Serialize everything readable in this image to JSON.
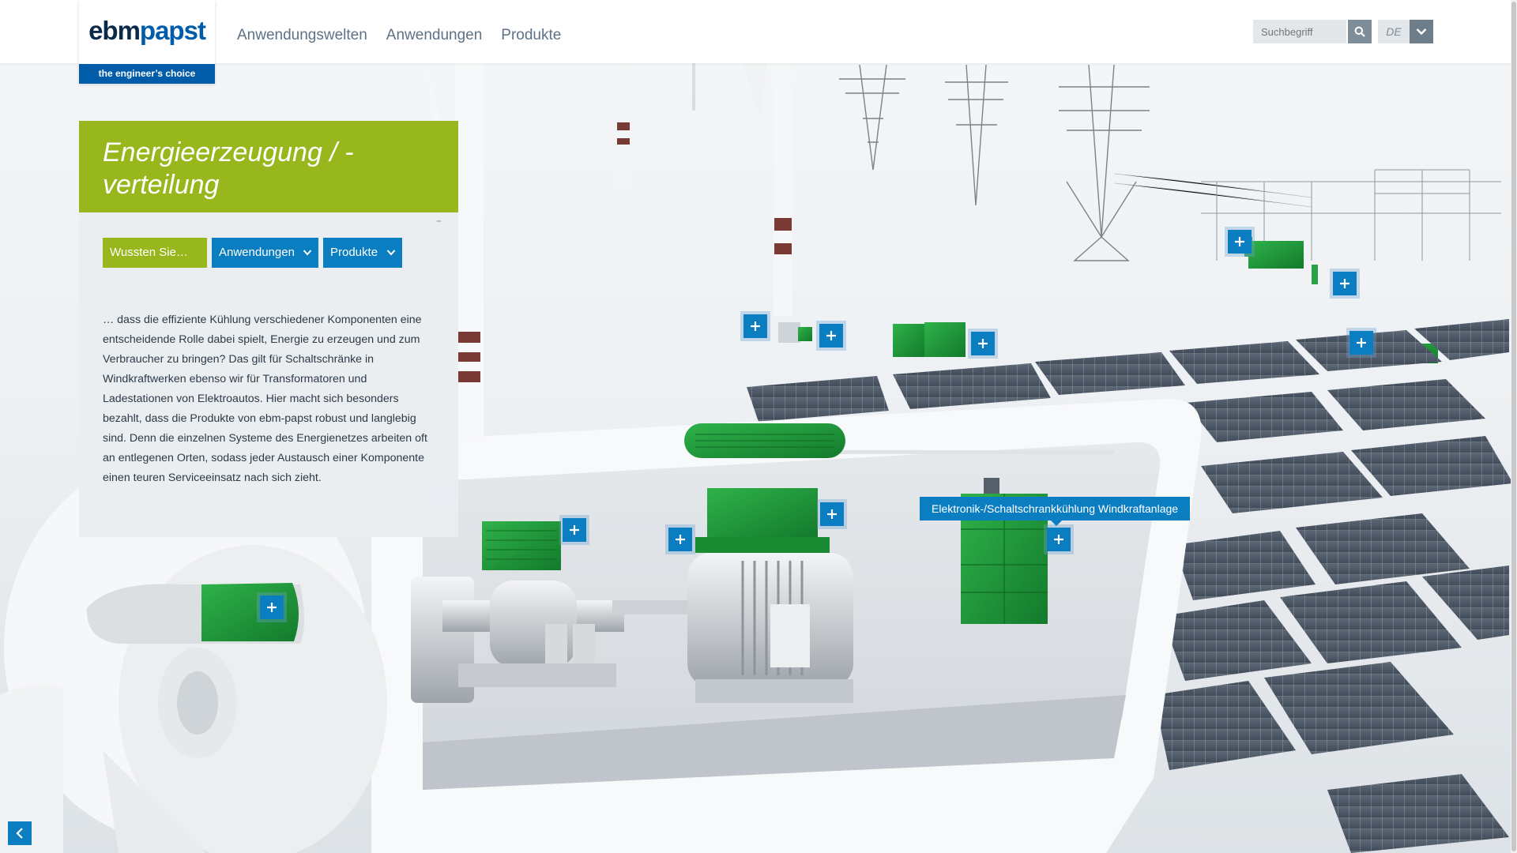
{
  "brand": {
    "logo_part1": "ebm",
    "logo_part2": "papst",
    "tagline": "the engineer’s choice"
  },
  "nav": {
    "items": [
      "Anwendungswelten",
      "Anwendungen",
      "Produkte"
    ]
  },
  "search": {
    "placeholder": "Suchbegriff"
  },
  "language": {
    "selected": "DE"
  },
  "panel": {
    "title": "Energieerzeugung / - verteilung",
    "collapse_label": "–",
    "tabs": [
      {
        "label": "Wussten Sie…"
      },
      {
        "label": "Anwendungen"
      },
      {
        "label": "Produkte"
      }
    ],
    "description": "… dass die effiziente Kühlung verschiedener Komponenten eine entscheidende Rolle dabei spielt, Energie zu erzeugen und zum Verbraucher zu bringen? Das gilt für Schaltschränke in Windkraftwerken ebenso wir für Transformatoren und Ladestationen von Elektroautos. Hier macht sich besonders bezahlt, dass die Produkte von ebm-papst robust und langlebig sind. Denn die einzelnen Systeme des Energienetzes arbeiten oft an entlegenen Orten, sodass jeder Austausch einer Komponente einen teuren Serviceeinsatz nach sich zieht."
  },
  "tooltip": {
    "label": "Elektronik-/Schaltschrankkühlung Windkraftanlage"
  },
  "colors": {
    "brand_blue": "#005ca9",
    "hotspot_blue": "#0b7dc1",
    "panel_green": "#97b71c",
    "component_green": "#1f9a3a"
  },
  "icons": {
    "search": "search-icon",
    "dropdown": "chevron-down-icon",
    "hotspot": "plus-icon",
    "back": "chevron-left-icon"
  }
}
